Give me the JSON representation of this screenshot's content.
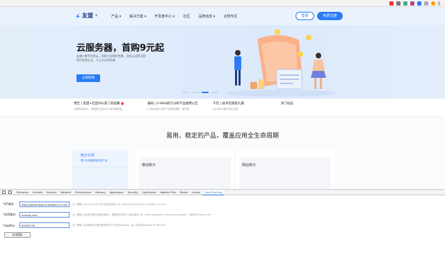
{
  "header": {
    "logo_text": "友盟",
    "logo_plus": "+",
    "nav": [
      "产品 ▾",
      "解决方案 ▾",
      "开发者中心 ▾",
      "社区",
      "品牌动态 ▾",
      "合规专区"
    ],
    "login_label": "登录",
    "register_label": "免费注册"
  },
  "hero": {
    "title": "云服务器，首购9元起",
    "desc": "友盟+携手阿里云，多款产品限时特惠，注册认证即可获得代金券礼金，千元大礼等你拿",
    "button_label": "立即抢购"
  },
  "news": [
    {
      "title": "预告 | 友盟+社区KOL第二轮招募",
      "sub": "立即报名参与，申请成为社区KOL享专属权益"
    },
    {
      "title": "通知 | U-Web统计分析产品规费公告",
      "sub": "U-Web统计分析产品规费调整，请知悉"
    },
    {
      "title": "干货 | 技术实践第九期",
      "sub": "View的卡顿与优化实践"
    },
    {
      "title": "热门动态",
      "sub": ""
    }
  ],
  "products": {
    "section_title": "易用、稳定的产品，覆盖应用全生命周期",
    "active_card_title": "统计分析",
    "active_card_sub": "基于全场景数据分析产品",
    "cards": [
      "移动统计",
      "网站统计"
    ]
  },
  "devtools": {
    "tabs": [
      "Elements",
      "Console",
      "Sources",
      "Network",
      "Performance",
      "Memory",
      "Application",
      "Security",
      "Lighthouse",
      "Adblock Plus",
      "Redux",
      "Layers",
      "QuickTracking"
    ],
    "active_tab": "QuickTracking",
    "fields": [
      {
        "label": "*QT域名:",
        "value": "http://portal.qtplus.alibaba-inc.com",
        "hint": "注: 请输入QuickTracking产品后台域名 eg. http://portal.qtplus.alibaba-inc.com"
      },
      {
        "label": "*应用域名:",
        "value": "umeng.com",
        "hint": "注: 请输入应用所埋点页面的域名，请精准到项目二级主域名 eg. https://passport.umeng.com/login，请填写umeng.com"
      },
      {
        "label": "*appKey:",
        "value": "65963130",
        "hint": "注: 请输入应用埋点页面所使用的QT平台的appKey, eg. 应用的appKey 65963130"
      }
    ],
    "save_label": "点击保存"
  },
  "colors": {
    "brand": "#2a7cf6",
    "hero_bg": "#dbe9fb"
  }
}
